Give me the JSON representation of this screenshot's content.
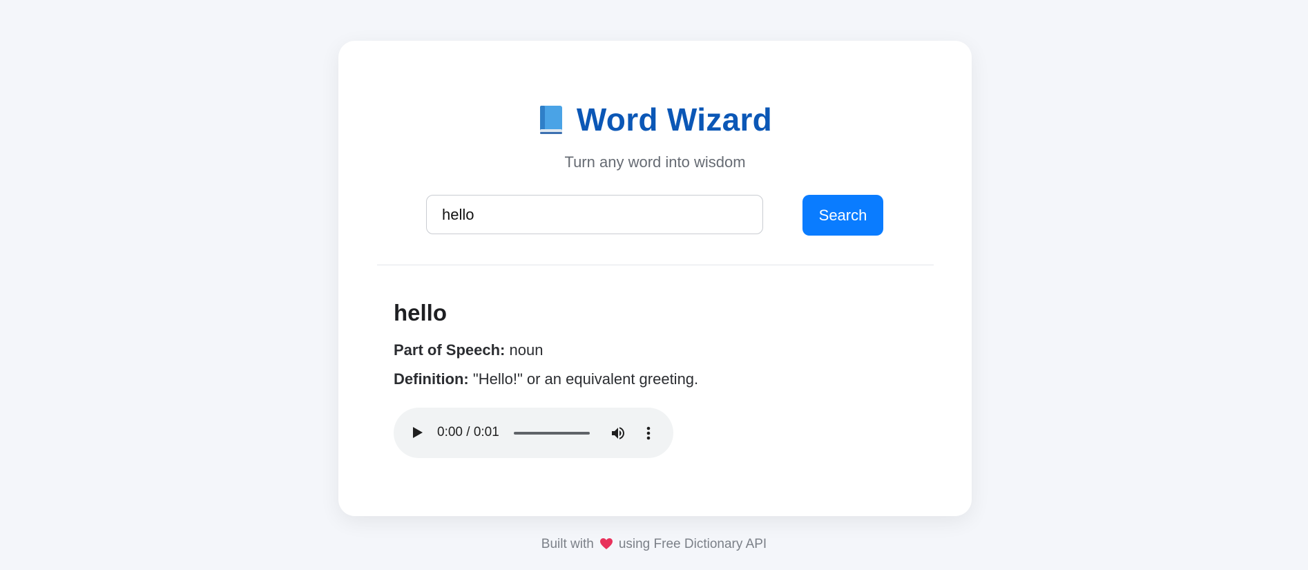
{
  "header": {
    "title": "Word Wizard",
    "title_icon": "book-icon",
    "subtitle": "Turn any word into wisdom"
  },
  "search": {
    "value": "hello",
    "placeholder": "",
    "button_label": "Search"
  },
  "result": {
    "word": "hello",
    "pos_label": "Part of Speech:",
    "pos_value": "noun",
    "def_label": "Definition:",
    "def_value": "\"Hello!\" or an equivalent greeting."
  },
  "audio": {
    "time": "0:00 / 0:01",
    "progress": 0,
    "icons": [
      "play-icon",
      "volume-icon",
      "more-vert-icon"
    ]
  },
  "footer": {
    "prefix": "Built with",
    "icon": "heart-icon",
    "suffix": "using Free Dictionary API"
  },
  "colors": {
    "accent": "#0a7cff",
    "title": "#0b57b6",
    "background": "#f4f6fa"
  }
}
